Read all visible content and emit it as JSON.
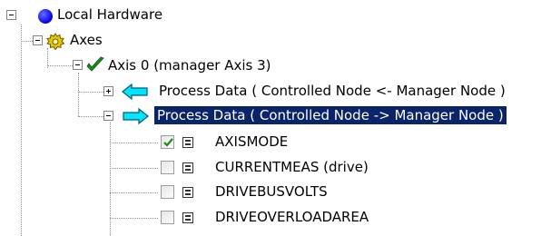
{
  "tree": {
    "root": {
      "label": "Local Hardware",
      "icon": "blue-circle-icon",
      "expanded": true
    },
    "axes": {
      "label": "Axes",
      "icon": "gear-icon",
      "expanded": true
    },
    "axis0": {
      "label": "Axis 0 (manager Axis 3)",
      "icon": "green-checkmark-icon",
      "expanded": true
    },
    "process_data_in": {
      "label": "Process Data ( Controlled Node <- Manager Node )",
      "icon": "left-arrow-icon",
      "expanded": false
    },
    "process_data_out": {
      "label": "Process Data ( Controlled Node -> Manager Node )",
      "icon": "right-arrow-icon",
      "expanded": true,
      "selected": true
    },
    "signals": [
      {
        "label": "AXISMODE",
        "checked": true
      },
      {
        "label": "CURRENTMEAS (drive)",
        "checked": false
      },
      {
        "label": "DRIVEBUSVOLTS",
        "checked": false
      },
      {
        "label": "DRIVEOVERLOADAREA",
        "checked": false
      }
    ]
  },
  "colors": {
    "selection_bg": "#0a246a",
    "arrow_cyan": "#00e5ff",
    "root_blue": "#0000ff",
    "check_green": "#1a8a1a",
    "gear_yellow": "#e6c800"
  }
}
